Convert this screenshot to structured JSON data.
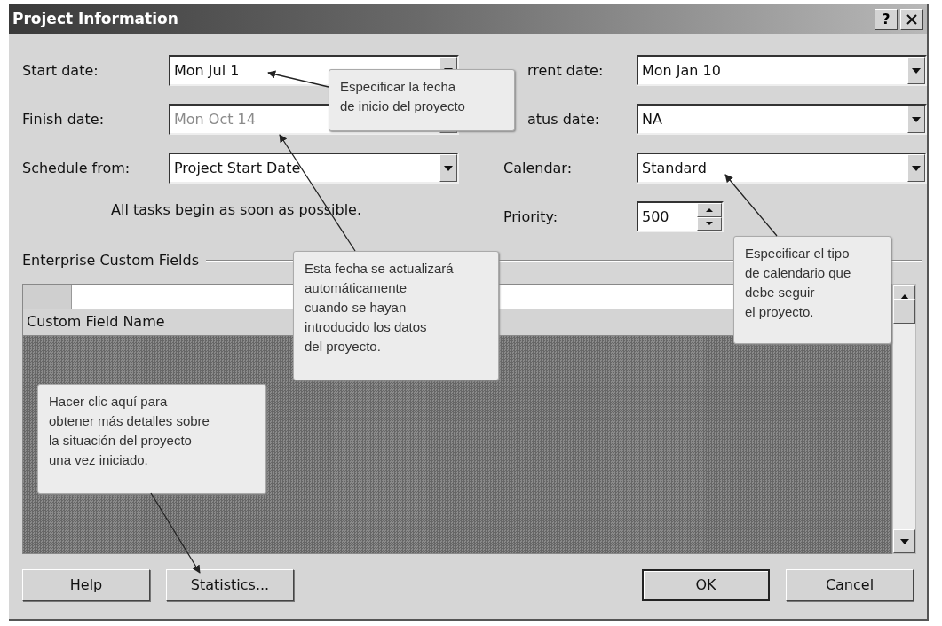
{
  "window": {
    "title": "Project Information",
    "help_button": "?"
  },
  "left_fields": [
    {
      "label": "Start date:",
      "value": "Mon Jul 1",
      "kind": "dropdown",
      "disabled": false
    },
    {
      "label": "Finish date:",
      "value": "Mon Oct 14",
      "kind": "dropdown",
      "disabled": true
    },
    {
      "label": "Schedule from:",
      "value": "Project Start Date",
      "kind": "dropdown",
      "disabled": false
    }
  ],
  "schedule_note": "All tasks begin as soon as possible.",
  "right_fields": [
    {
      "label": "rrent date:",
      "value": "Mon Jan 10",
      "kind": "dropdown",
      "covered": true
    },
    {
      "label": "atus date:",
      "value": "NA",
      "kind": "dropdown",
      "covered": true
    },
    {
      "label": "Calendar:",
      "value": "Standard",
      "kind": "dropdown",
      "covered": false
    },
    {
      "label": "Priority:",
      "value": "500",
      "kind": "spinner",
      "covered": false
    }
  ],
  "group": {
    "label": "Enterprise Custom Fields",
    "columns": [
      "Custom Field Name"
    ]
  },
  "left_buttons": [
    {
      "label": "Help",
      "default": false
    },
    {
      "label": "Statistics...",
      "default": false
    }
  ],
  "right_buttons": [
    {
      "label": "OK",
      "default": true
    },
    {
      "label": "Cancel",
      "default": false
    }
  ],
  "callouts": [
    {
      "text": "Especificar la fecha\nde inicio del proyecto"
    },
    {
      "text": "Esta fecha se actualizará\nautomáticamente\ncuando se hayan\nintroducido los datos\ndel proyecto."
    },
    {
      "text": "Especificar el tipo\nde calendario que\ndebe seguir\nel proyecto."
    },
    {
      "text": "Hacer clic aquí para\nobtener más detalles sobre\nla situación del proyecto\nuna vez iniciado."
    }
  ]
}
